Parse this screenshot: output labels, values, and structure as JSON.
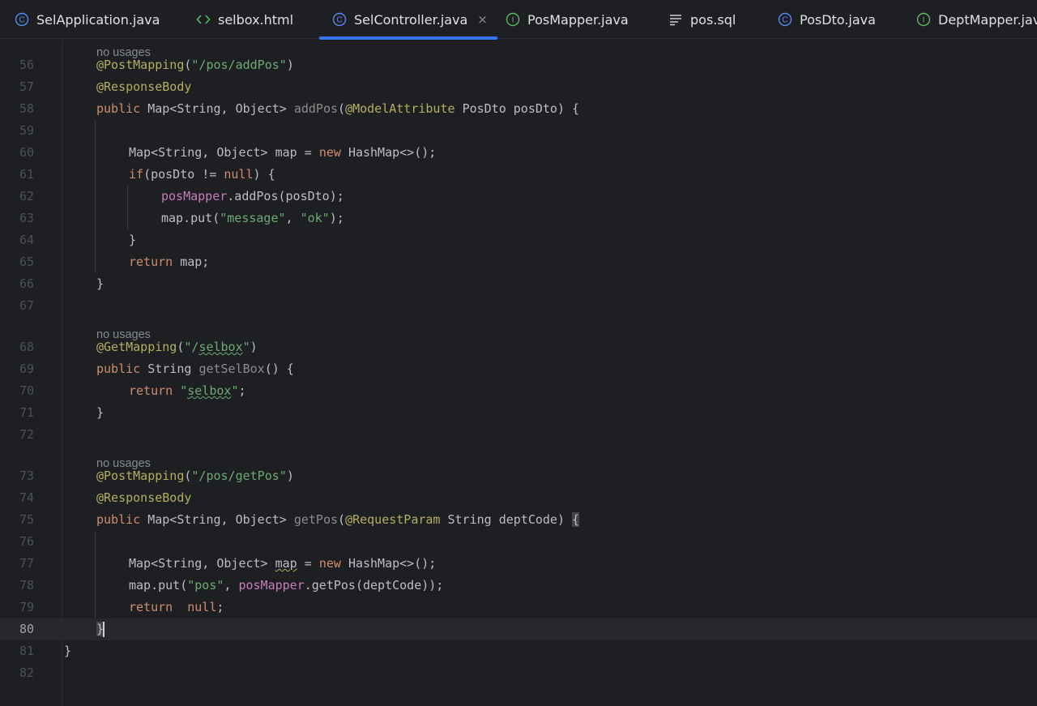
{
  "tabs": [
    {
      "label": "SelApplication.java",
      "icon": "class-icon",
      "active": false
    },
    {
      "label": "selbox.html",
      "icon": "html-icon",
      "active": false
    },
    {
      "label": "SelController.java",
      "icon": "class-icon",
      "active": true,
      "close": "×"
    },
    {
      "label": "PosMapper.java",
      "icon": "interface-icon",
      "active": false
    },
    {
      "label": "pos.sql",
      "icon": "sql-file-icon",
      "active": false
    },
    {
      "label": "PosDto.java",
      "icon": "class-icon",
      "active": false
    },
    {
      "label": "DeptMapper.java",
      "icon": "interface-icon",
      "active": false
    }
  ],
  "colors": {
    "keyword": "#cf8e6d",
    "annotation": "#b3ae60",
    "string": "#6aab73",
    "field": "#c77dbb",
    "text": "#bcbec4",
    "accent": "#3574f0"
  },
  "inlay_hint": "no usages",
  "current_line": "80",
  "lines": [
    {
      "hint": "no usages",
      "num": "56",
      "indent": 1,
      "tokens": [
        [
          "an",
          "@PostMapping"
        ],
        [
          "",
          "("
        ],
        [
          "str",
          "\"/pos/addPos\""
        ],
        [
          "",
          ")"
        ]
      ]
    },
    {
      "num": "57",
      "indent": 1,
      "tokens": [
        [
          "an",
          "@ResponseBody"
        ]
      ]
    },
    {
      "num": "58",
      "indent": 1,
      "tokens": [
        [
          "kw",
          "public "
        ],
        [
          "",
          "Map<String, Object> "
        ],
        [
          "fn-unused",
          "addPos"
        ],
        [
          "",
          "("
        ],
        [
          "an",
          "@ModelAttribute "
        ],
        [
          "",
          "PosDto posDto) {"
        ]
      ]
    },
    {
      "num": "59",
      "indent": 1,
      "tokens": []
    },
    {
      "num": "60",
      "indent": 2,
      "tokens": [
        [
          "",
          "Map<String, Object> map = "
        ],
        [
          "kw",
          "new "
        ],
        [
          "",
          "HashMap<>();"
        ]
      ]
    },
    {
      "num": "61",
      "indent": 2,
      "tokens": [
        [
          "kw",
          "if"
        ],
        [
          "",
          "(posDto != "
        ],
        [
          "kw",
          "null"
        ],
        [
          "",
          ") {"
        ]
      ]
    },
    {
      "num": "62",
      "indent": 3,
      "tokens": [
        [
          "fld",
          "posMapper"
        ],
        [
          "",
          ".addPos(posDto);"
        ]
      ]
    },
    {
      "num": "63",
      "indent": 3,
      "tokens": [
        [
          "",
          "map.put("
        ],
        [
          "str",
          "\"message\""
        ],
        [
          "",
          ", "
        ],
        [
          "str",
          "\"ok\""
        ],
        [
          "",
          ");"
        ]
      ]
    },
    {
      "num": "64",
      "indent": 2,
      "tokens": [
        [
          "",
          "}"
        ]
      ]
    },
    {
      "num": "65",
      "indent": 2,
      "tokens": [
        [
          "kw",
          "return "
        ],
        [
          "",
          "map;"
        ]
      ]
    },
    {
      "num": "66",
      "indent": 1,
      "tokens": [
        [
          "",
          "}"
        ]
      ]
    },
    {
      "num": "67",
      "indent": 1,
      "tokens": []
    },
    {
      "hint": "no usages",
      "num": "68",
      "indent": 1,
      "tokens": [
        [
          "an",
          "@GetMapping"
        ],
        [
          "",
          "("
        ],
        [
          "str",
          "\"/"
        ],
        [
          "str typo",
          "selbox"
        ],
        [
          "str",
          "\""
        ],
        [
          "",
          ")"
        ]
      ]
    },
    {
      "num": "69",
      "indent": 1,
      "tokens": [
        [
          "kw",
          "public "
        ],
        [
          "",
          "String "
        ],
        [
          "fn-unused",
          "getSelBox"
        ],
        [
          "",
          "() {"
        ]
      ]
    },
    {
      "num": "70",
      "indent": 2,
      "tokens": [
        [
          "kw",
          "return "
        ],
        [
          "str",
          "\""
        ],
        [
          "str typo",
          "selbox"
        ],
        [
          "str",
          "\""
        ],
        [
          "",
          ";"
        ]
      ]
    },
    {
      "num": "71",
      "indent": 1,
      "tokens": [
        [
          "",
          "}"
        ]
      ]
    },
    {
      "num": "72",
      "indent": 1,
      "tokens": []
    },
    {
      "hint": "no usages",
      "num": "73",
      "indent": 1,
      "tokens": [
        [
          "an",
          "@PostMapping"
        ],
        [
          "",
          "("
        ],
        [
          "str",
          "\"/pos/getPos\""
        ],
        [
          "",
          ")"
        ]
      ]
    },
    {
      "num": "74",
      "indent": 1,
      "tokens": [
        [
          "an",
          "@ResponseBody"
        ]
      ]
    },
    {
      "num": "75",
      "indent": 1,
      "tokens": [
        [
          "kw",
          "public "
        ],
        [
          "",
          "Map<String, Object> "
        ],
        [
          "fn-unused",
          "getPos"
        ],
        [
          "",
          "("
        ],
        [
          "an",
          "@RequestParam "
        ],
        [
          "",
          "String deptCode) "
        ],
        [
          "brace-hl",
          "{"
        ]
      ]
    },
    {
      "num": "76",
      "indent": 1,
      "tokens": []
    },
    {
      "num": "77",
      "indent": 2,
      "tokens": [
        [
          "",
          "Map<String, Object> "
        ],
        [
          "typo-unused",
          "map"
        ],
        [
          "",
          " = "
        ],
        [
          "kw",
          "new "
        ],
        [
          "",
          "HashMap<>();"
        ]
      ]
    },
    {
      "num": "78",
      "indent": 2,
      "tokens": [
        [
          "",
          "map.put("
        ],
        [
          "str",
          "\"pos\""
        ],
        [
          "",
          ", "
        ],
        [
          "fld",
          "posMapper"
        ],
        [
          "",
          ".getPos(deptCode));"
        ]
      ]
    },
    {
      "num": "79",
      "indent": 2,
      "tokens": [
        [
          "kw",
          "return  null"
        ],
        [
          "",
          ";"
        ]
      ]
    },
    {
      "num": "80",
      "indent": 1,
      "tokens": [
        [
          "brace-hl",
          "}"
        ],
        [
          "caret",
          ""
        ]
      ]
    },
    {
      "num": "81",
      "indent": 0,
      "tokens": [
        [
          "",
          "}"
        ]
      ]
    },
    {
      "num": "82",
      "indent": 0,
      "tokens": []
    }
  ]
}
